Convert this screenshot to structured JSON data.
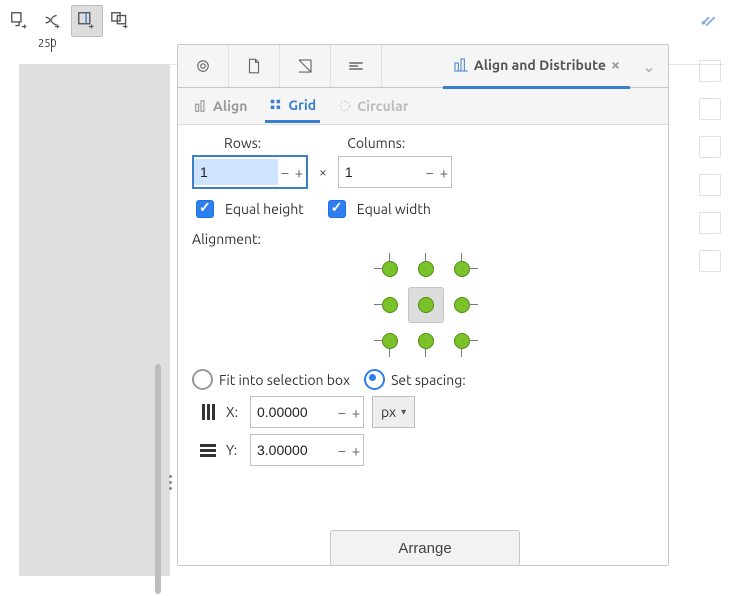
{
  "ruler": {
    "label": "250"
  },
  "toolbar": {
    "icons": [
      "snap-node",
      "snap-intersection",
      "snap-guide",
      "snap-bbox",
      "snap-toggle"
    ]
  },
  "dock": {
    "title": "Align and Distribute",
    "icons": [
      "layers-icon",
      "document-icon",
      "trace-icon",
      "levels-icon"
    ],
    "subtabs": {
      "align": "Align",
      "grid": "Grid",
      "circular": "Circular"
    }
  },
  "panel": {
    "rows_label": "Rows:",
    "columns_label": "Columns:",
    "rows_value": "1",
    "columns_value": "1",
    "equal_height": "Equal height",
    "equal_width": "Equal width",
    "alignment": "Alignment:",
    "fit": "Fit into selection box",
    "spacing": "Set spacing:",
    "x_label": "X:",
    "y_label": "Y:",
    "x_value": "0.00000",
    "y_value": "3.00000",
    "unit": "px",
    "arrange": "Arrange"
  }
}
